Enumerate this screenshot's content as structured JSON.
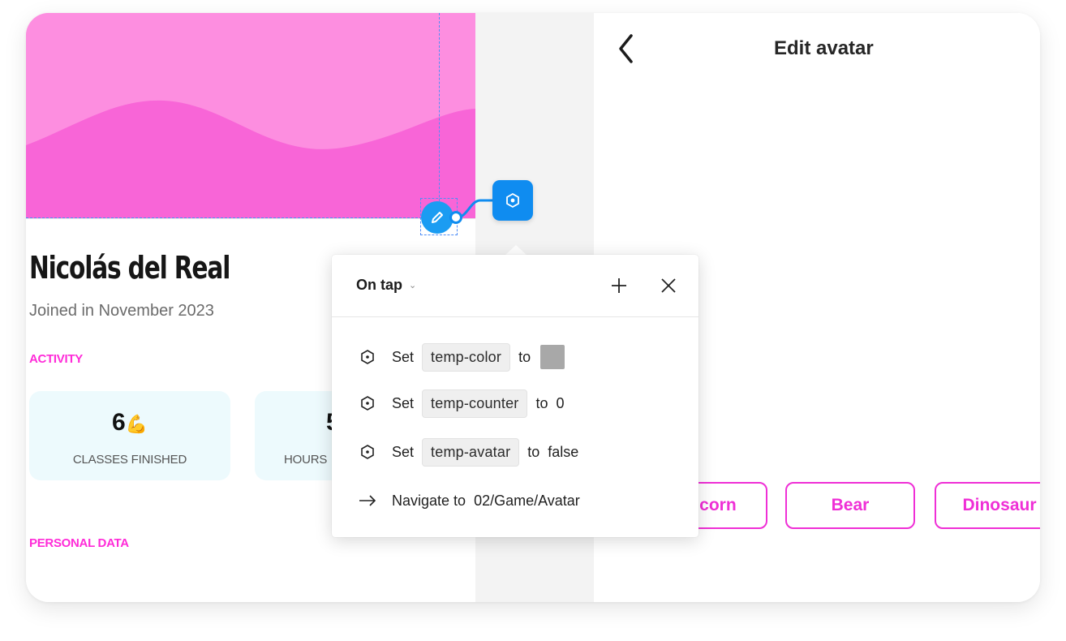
{
  "profile": {
    "name": "Nicolás del Real",
    "joined": "Joined in November 2023",
    "activity_label": "ACTIVITY",
    "personal_label": "PERSONAL DATA",
    "stats": [
      {
        "value": "6",
        "emoji": "💪",
        "label": "CLASSES FINISHED"
      },
      {
        "value": "5",
        "label": "HOURS"
      }
    ],
    "hero_color": "#fd8ee0"
  },
  "edit_avatar": {
    "title": "Edit avatar",
    "options": [
      "Unicorn",
      "Bear",
      "Dinosaur"
    ],
    "accent": "#ef2fd6"
  },
  "interaction": {
    "trigger": "On tap",
    "actions": [
      {
        "verb": "Set",
        "variable": "temp-color",
        "to": "to",
        "value_color": "#a8a8a8"
      },
      {
        "verb": "Set",
        "variable": "temp-counter",
        "to": "to",
        "value": "0"
      },
      {
        "verb": "Set",
        "variable": "temp-avatar",
        "to": "to",
        "value": "false"
      },
      {
        "verb": "Navigate to",
        "target": "02/Game/Avatar"
      }
    ]
  }
}
